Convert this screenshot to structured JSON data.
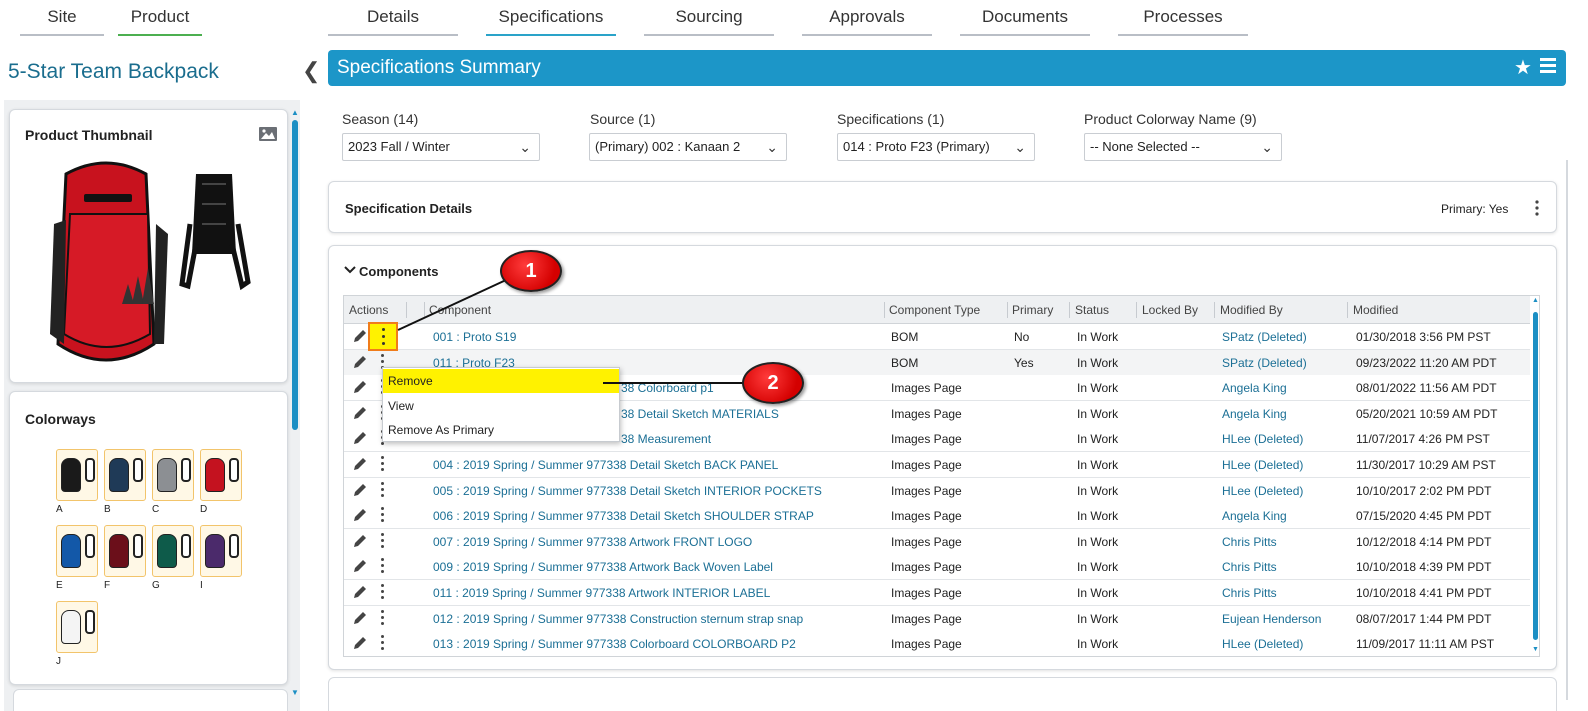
{
  "nav": {
    "left_tabs": [
      "Site",
      "Product"
    ],
    "tabs": [
      "Details",
      "Specifications",
      "Sourcing",
      "Approvals",
      "Documents",
      "Processes"
    ],
    "active_tab": "Specifications"
  },
  "product": {
    "title": "5-Star Team Backpack",
    "thumbnail_title": "Product Thumbnail",
    "colorways_title": "Colorways",
    "colorways": [
      {
        "label": "A",
        "color": "#1a1a1a"
      },
      {
        "label": "B",
        "color": "#1f3a57"
      },
      {
        "label": "C",
        "color": "#8c8f93"
      },
      {
        "label": "D",
        "color": "#c4121f"
      },
      {
        "label": "E",
        "color": "#1358a8"
      },
      {
        "label": "F",
        "color": "#6b0f1a"
      },
      {
        "label": "G",
        "color": "#0e5b4a"
      },
      {
        "label": "I",
        "color": "#4b2a6b"
      },
      {
        "label": "J",
        "color": "#f4f4f4"
      }
    ]
  },
  "summary": {
    "title": "Specifications Summary",
    "filters": [
      {
        "label": "Season (14)",
        "value": "2023 Fall / Winter"
      },
      {
        "label": "Source (1)",
        "value": "(Primary) 002 : Kanaan 2"
      },
      {
        "label": "Specifications (1)",
        "value": "014 : Proto F23 (Primary)"
      },
      {
        "label": "Product Colorway Name (9)",
        "value": "-- None Selected --"
      }
    ]
  },
  "spec_details": {
    "title": "Specification Details",
    "primary": "Primary: Yes"
  },
  "components": {
    "title": "Components",
    "headers": [
      "Actions",
      "Component",
      "Component Type",
      "Primary",
      "Status",
      "Locked By",
      "Modified By",
      "Modified"
    ],
    "rows": [
      {
        "component": "001 : Proto S19",
        "type": "BOM",
        "primary": "No",
        "status": "In Work",
        "modified_by": "SPatz (Deleted)",
        "modified": "01/30/2018 3:56 PM PST"
      },
      {
        "component": "011 : Proto F23",
        "type": "BOM",
        "primary": "Yes",
        "status": "In Work",
        "modified_by": "SPatz (Deleted)",
        "modified": "09/23/2022 11:20 AM PDT"
      },
      {
        "component": "38 Colorboard p1",
        "type": "Images Page",
        "primary": "",
        "status": "In Work",
        "modified_by": "Angela King",
        "modified": "08/01/2022 11:56 AM PDT"
      },
      {
        "component": "38 Detail Sketch MATERIALS",
        "type": "Images Page",
        "primary": "",
        "status": "In Work",
        "modified_by": "Angela King",
        "modified": "05/20/2021 10:59 AM PDT"
      },
      {
        "component": "38 Measurement",
        "type": "Images Page",
        "primary": "",
        "status": "In Work",
        "modified_by": "HLee (Deleted)",
        "modified": "11/07/2017 4:26 PM PST"
      },
      {
        "component": "004 : 2019 Spring / Summer  977338 Detail Sketch BACK PANEL",
        "type": "Images Page",
        "primary": "",
        "status": "In Work",
        "modified_by": "HLee (Deleted)",
        "modified": "11/30/2017 10:29 AM PST"
      },
      {
        "component": "005 : 2019 Spring / Summer  977338 Detail Sketch INTERIOR POCKETS",
        "type": "Images Page",
        "primary": "",
        "status": "In Work",
        "modified_by": "HLee (Deleted)",
        "modified": "10/10/2017 2:02 PM PDT"
      },
      {
        "component": "006 : 2019 Spring / Summer  977338 Detail Sketch SHOULDER STRAP",
        "type": "Images Page",
        "primary": "",
        "status": "In Work",
        "modified_by": "Angela King",
        "modified": "07/15/2020 4:45 PM PDT"
      },
      {
        "component": "007 : 2019 Spring / Summer  977338 Artwork FRONT LOGO",
        "type": "Images Page",
        "primary": "",
        "status": "In Work",
        "modified_by": "Chris Pitts",
        "modified": "10/12/2018 4:14 PM PDT"
      },
      {
        "component": "009 : 2019 Spring / Summer  977338 Artwork Back Woven Label",
        "type": "Images Page",
        "primary": "",
        "status": "In Work",
        "modified_by": "Chris Pitts",
        "modified": "10/10/2018 4:39 PM PDT"
      },
      {
        "component": "011 : 2019 Spring / Summer  977338 Artwork INTERIOR LABEL",
        "type": "Images Page",
        "primary": "",
        "status": "In Work",
        "modified_by": "Chris Pitts",
        "modified": "10/10/2018 4:41 PM PDT"
      },
      {
        "component": "012 : 2019 Spring / Summer  977338 Construction sternum strap snap",
        "type": "Images Page",
        "primary": "",
        "status": "In Work",
        "modified_by": "Eujean Henderson",
        "modified": "08/07/2017 1:44 PM PDT"
      },
      {
        "component": "013 : 2019 Spring / Summer  977338 Colorboard COLORBOARD P2",
        "type": "Images Page",
        "primary": "",
        "status": "In Work",
        "modified_by": "HLee (Deleted)",
        "modified": "11/09/2017 11:11 AM PST"
      }
    ]
  },
  "context_menu": {
    "items": [
      "Remove",
      "View",
      "Remove As Primary"
    ],
    "highlighted": "Remove"
  },
  "callouts": [
    "1",
    "2"
  ],
  "colors": {
    "accent": "#1c96c8",
    "link": "#1b6f95",
    "highlight": "#fff200",
    "callout_red": "#d40000"
  }
}
